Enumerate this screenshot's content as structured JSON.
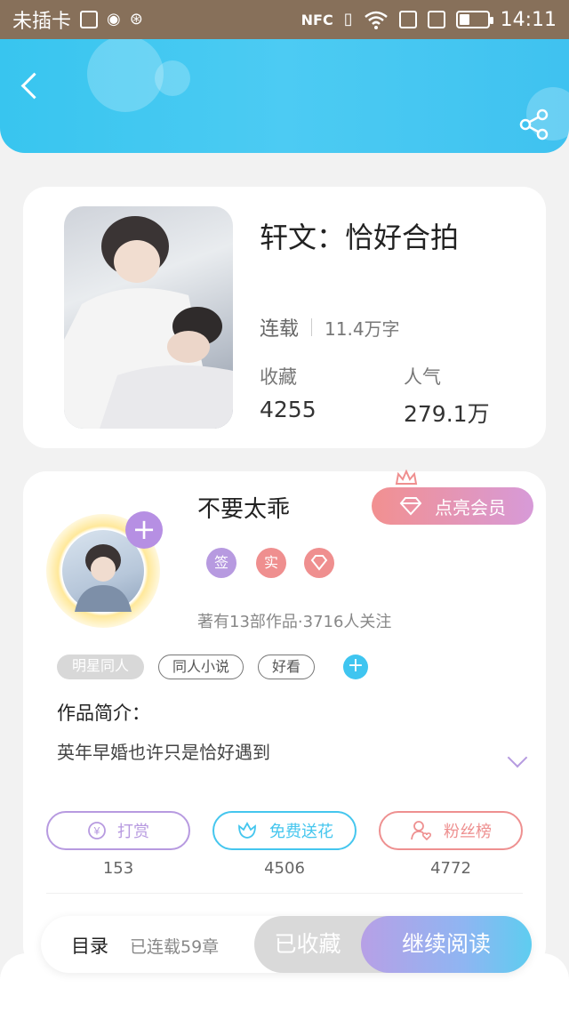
{
  "status_bar": {
    "carrier": "未插卡",
    "nfc": "NFC",
    "time": "14:11",
    "battery_level": 0.35
  },
  "book": {
    "title": "轩文：恰好合拍",
    "status": "连载",
    "word_count": "11.4万字",
    "favorites_label": "收藏",
    "favorites_value": "4255",
    "popularity_label": "人气",
    "popularity_value": "279.1万"
  },
  "author": {
    "name": "不要太乖",
    "vip_button": "点亮会员",
    "badges": [
      "签",
      "实"
    ],
    "meta": "著有13部作品·3716人关注",
    "tags": [
      "明星同人",
      "同人小说",
      "好看"
    ]
  },
  "intro": {
    "label": "作品简介：",
    "text": "英年早婚也许只是恰好遇到"
  },
  "actions": [
    {
      "label": "打赏",
      "count": "153",
      "color": "#b79ae0"
    },
    {
      "label": "免费送花",
      "count": "4506",
      "color": "#45c6ee"
    },
    {
      "label": "粉丝榜",
      "count": "4772",
      "color": "#ee9090"
    }
  ],
  "bottom_bar": {
    "toc_label": "目录",
    "toc_count": "已连载59章",
    "favorited_label": "已收藏",
    "continue_label": "继续阅读"
  },
  "colors": {
    "header_blue": "#3fc5f0",
    "vip_gradient_start": "#f29090",
    "vip_gradient_end": "#d79ad8"
  }
}
